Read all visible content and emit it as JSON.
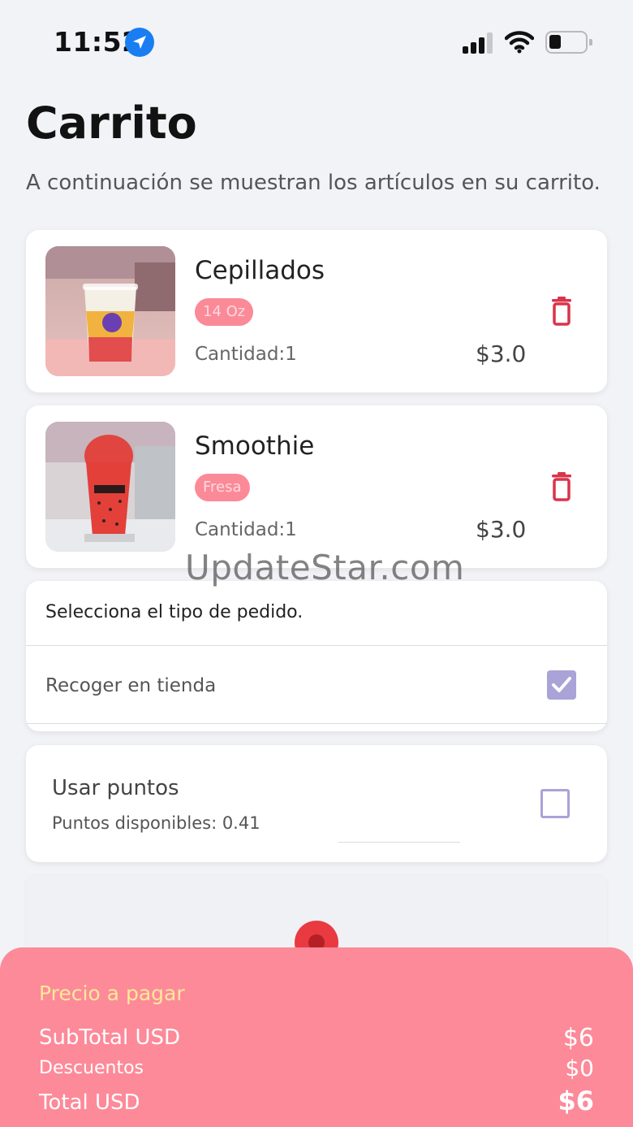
{
  "status_bar": {
    "time": "11:52"
  },
  "page": {
    "title": "Carrito",
    "subtitle": "A continuación se muestran los artículos en su carrito."
  },
  "cart_items": [
    {
      "name": "Cepillados",
      "variant": "14 Oz",
      "quantity": "Cantidad:1",
      "price": "$3.0"
    },
    {
      "name": "Smoothie",
      "variant": "Fresa",
      "quantity": "Cantidad:1",
      "price": "$3.0"
    }
  ],
  "watermark": "UpdateStar.com",
  "order_type": {
    "header": "Selecciona el tipo de pedido.",
    "option_label": "Recoger en tienda",
    "option_checked": true
  },
  "points": {
    "title": "Usar puntos",
    "available": "Puntos disponibles: 0.41",
    "checked": false
  },
  "summary": {
    "title": "Precio a pagar",
    "subtotal_label": "SubTotal USD",
    "subtotal_value": "$6",
    "discount_label": "Descuentos",
    "discount_value": "$0",
    "total_label": "Total USD",
    "total_value": "$6"
  },
  "colors": {
    "accent_pink": "#fd8a99",
    "badge_pink": "#fb8a98",
    "trash_red": "#d9344a",
    "checkbox_purple": "#a9a3d8",
    "summary_title_yellow": "#fde89a"
  },
  "icons": [
    "location-arrow-icon",
    "signal-icon",
    "wifi-icon",
    "battery-icon",
    "trash-icon",
    "checkmark-icon",
    "map-pin-icon"
  ]
}
